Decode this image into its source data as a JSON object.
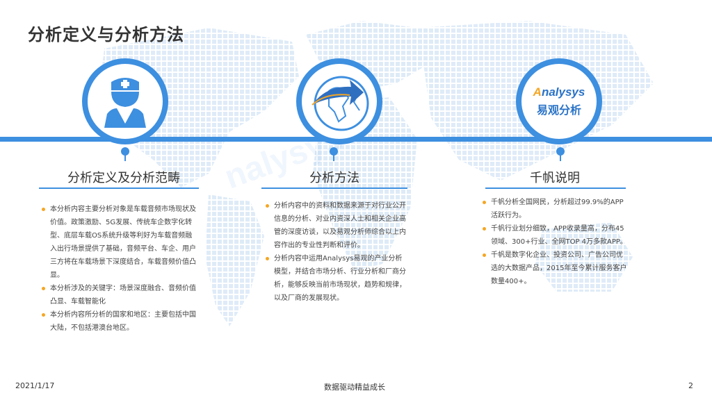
{
  "page": {
    "title": "分析定义与分析方法",
    "watermark": "nalysys"
  },
  "sections": [
    {
      "heading": "分析定义及分析范畴",
      "icon": "doctor-icon",
      "bullets": [
        "本分析内容主要分析对象是车载音频市场现状及价值。政策激励、5G发展、传统车企数字化转型、底层车载OS系统升级等利好为车载音频融入出行场景提供了基础，音频平台、车企、用户三方将在车载场景下深度结合，车载音频价值凸显。",
        "本分析涉及的关键字：场景深度融合、音频价值凸显、车载智能化",
        "本分析内容所分析的国家和地区：主要包括中国大陆，不包括港澳台地区。"
      ]
    },
    {
      "heading": "分析方法",
      "icon": "globe-arrow-icon",
      "bullets": [
        "分析内容中的资料和数据来源于对行业公开信息的分析、对业内资深人士和相关企业高管的深度访谈，以及易观分析师综合以上内容作出的专业性判断和评价。",
        "分析内容中运用Analysys易观的产业分析模型，并结合市场分析、行业分析和厂商分析，能够反映当前市场现状，趋势和规律，以及厂商的发展现状。"
      ]
    },
    {
      "heading": "千帆说明",
      "icon": "analysys-logo",
      "logo_text": "nalysys",
      "logo_sub": "易观分析",
      "bullets": [
        "千帆分析全国网民，分析超过99.9%的APP活跃行为。",
        "千帆行业划分细致，APP收录量高，分布45领域、300+行业、全网TOP 4万多款APP。",
        "千帆是数字化企业、投资公司、广告公司优选的大数据产品，2015年至今累计服务客户数量400+。"
      ]
    }
  ],
  "footer": {
    "date": "2021/1/17",
    "slogan": "数据驱动精益成长",
    "page_number": "2"
  },
  "colors": {
    "accent": "#3d8fe0",
    "bullet": "#f5a623"
  }
}
